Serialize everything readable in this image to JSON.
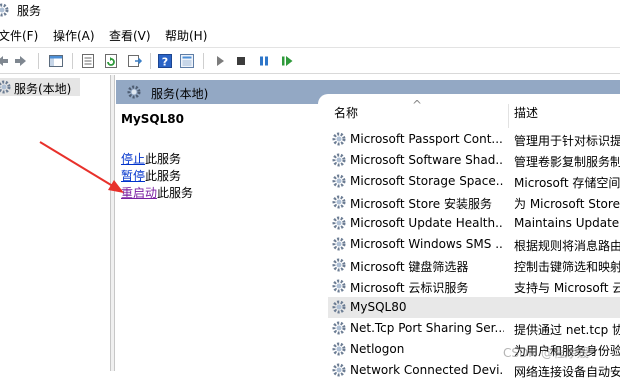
{
  "window": {
    "title": "服务"
  },
  "menu": [
    "文件(F)",
    "操作(A)",
    "查看(V)",
    "帮助(H)"
  ],
  "toolbar": {
    "buttons": [
      "back-icon",
      "forward-icon",
      "console-tree-icon",
      "properties-icon",
      "refresh-icon",
      "export-icon",
      "help-icon",
      "info-icon",
      "start-icon",
      "stop-icon",
      "pause-icon",
      "restart-icon"
    ]
  },
  "tree": {
    "item_label": "服务(本地)"
  },
  "header": {
    "label": "服务(本地)"
  },
  "detail": {
    "service_name": "MySQL80",
    "actions": [
      {
        "link": "停止",
        "suffix": "此服务"
      },
      {
        "link": "暂停",
        "suffix": "此服务"
      },
      {
        "link": "重启动",
        "suffix": "此服务"
      }
    ]
  },
  "list": {
    "columns": {
      "name": "名称",
      "description": "描述"
    },
    "sort_indicator": "^",
    "rows": [
      {
        "name": "Microsoft Passport Cont...",
        "description": "管理用于针对标识提"
      },
      {
        "name": "Microsoft Software Shad...",
        "description": "管理卷影复制服务制"
      },
      {
        "name": "Microsoft Storage Space...",
        "description": "Microsoft 存储空间"
      },
      {
        "name": "Microsoft Store 安装服务",
        "description": "为 Microsoft Store"
      },
      {
        "name": "Microsoft Update Health...",
        "description": "Maintains Update"
      },
      {
        "name": "Microsoft Windows SMS ...",
        "description": "根据规则将消息路由"
      },
      {
        "name": "Microsoft 键盘筛选器",
        "description": "控制击键筛选和映射"
      },
      {
        "name": "Microsoft 云标识服务",
        "description": "支持与 Microsoft 云"
      },
      {
        "name": "MySQL80",
        "description": ""
      },
      {
        "name": "Net.Tcp Port Sharing Ser...",
        "description": "提供通过 net.tcp 协"
      },
      {
        "name": "Netlogon",
        "description": "为用户和服务身份验"
      },
      {
        "name": "Network Connected Devi...",
        "description": "网络连接设备自动安"
      }
    ]
  },
  "watermark": "CSDN @程序媛",
  "colors": {
    "header_band": "#93a8c4",
    "link": "#0033cc",
    "visited_link": "#7a1fa2",
    "arrow": "#e8312b"
  }
}
